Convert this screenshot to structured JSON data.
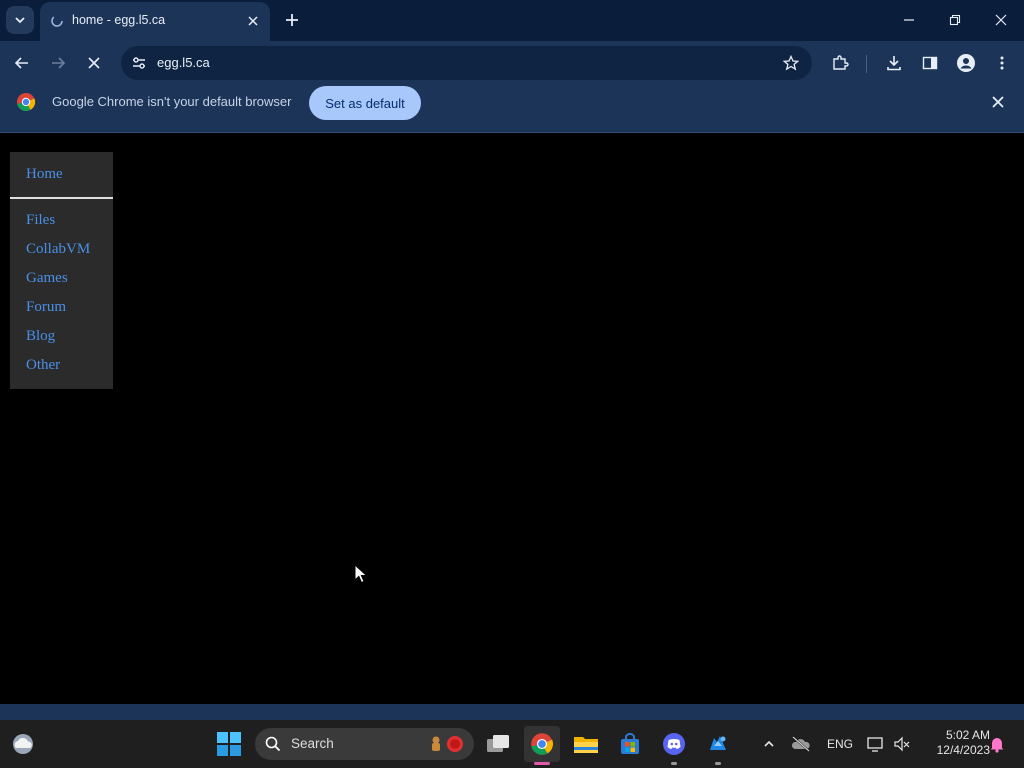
{
  "browser": {
    "tab": {
      "title": "home - egg.l5.ca"
    },
    "address": {
      "url": "egg.l5.ca"
    }
  },
  "infobar": {
    "message": "Google Chrome isn't your default browser",
    "button_label": "Set as default"
  },
  "nav": {
    "home": "Home",
    "items": [
      {
        "label": "Files"
      },
      {
        "label": "CollabVM"
      },
      {
        "label": "Games"
      },
      {
        "label": "Forum"
      },
      {
        "label": "Blog"
      },
      {
        "label": "Other"
      }
    ]
  },
  "taskbar": {
    "search_placeholder": "Search",
    "language": "ENG",
    "time": "5:02 AM",
    "date": "12/4/2023"
  },
  "colors": {
    "chrome_frame": "#0a1e3c",
    "chrome_toolbar": "#1b3458",
    "link_blue": "#4a8fe7",
    "nav_bg": "#2b2b2b",
    "infobar_button": "#a8c7fa",
    "taskbar_bg": "#1f1f1f"
  }
}
